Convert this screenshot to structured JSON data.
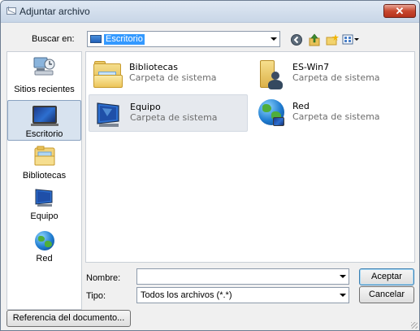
{
  "window": {
    "title": "Adjuntar archivo",
    "close_label": "✕"
  },
  "toolbar": {
    "lookin_label": "Buscar en:",
    "lookin_value": "Escritorio",
    "icons": [
      "back-icon",
      "up-folder-icon",
      "new-folder-icon",
      "view-menu-icon"
    ]
  },
  "places": [
    {
      "label": "Sitios recientes",
      "icon": "recent-places-icon",
      "selected": false
    },
    {
      "label": "Escritorio",
      "icon": "desktop-icon",
      "selected": true
    },
    {
      "label": "Bibliotecas",
      "icon": "libraries-icon",
      "selected": false
    },
    {
      "label": "Equipo",
      "icon": "computer-icon",
      "selected": false
    },
    {
      "label": "Red",
      "icon": "network-icon",
      "selected": false
    }
  ],
  "files": [
    {
      "name": "Bibliotecas",
      "desc": "Carpeta de sistema",
      "icon": "libraries-folder-icon",
      "selected": false
    },
    {
      "name": "ES-Win7",
      "desc": "Carpeta de sistema",
      "icon": "user-folder-icon",
      "selected": false
    },
    {
      "name": "Equipo",
      "desc": "Carpeta de sistema",
      "icon": "computer-icon",
      "selected": true
    },
    {
      "name": "Red",
      "desc": "Carpeta de sistema",
      "icon": "network-icon",
      "selected": false
    }
  ],
  "bottom": {
    "name_label": "Nombre:",
    "name_value": "",
    "type_label": "Tipo:",
    "type_value": "Todos los archivos (*.*)",
    "accept_label": "Aceptar",
    "cancel_label": "Cancelar",
    "doc_ref_label": "Referencia del documento..."
  },
  "colors": {
    "selection": "#3399ff",
    "close_button": "#c8482f",
    "title_bar": "#c8d6e7"
  }
}
